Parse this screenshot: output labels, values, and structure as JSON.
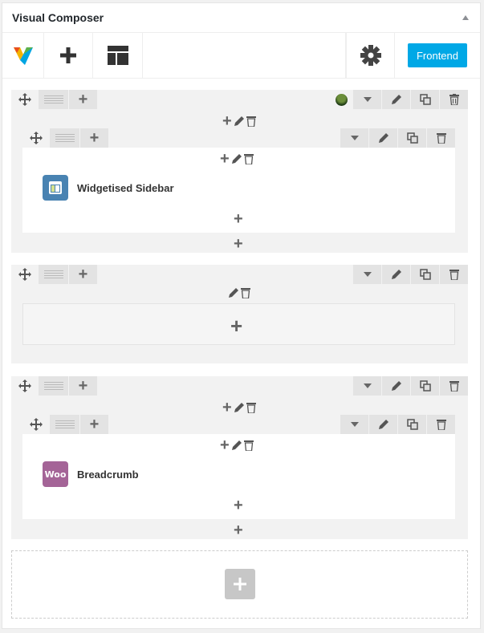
{
  "panel": {
    "title": "Visual Composer"
  },
  "toolbar": {
    "logo_icon": "vc-logo-icon",
    "add_icon": "plus-icon",
    "layout_icon": "templates-icon",
    "settings_icon": "gear-icon",
    "frontend_label": "Frontend"
  },
  "rows": [
    {
      "has_design": true,
      "inner_columns": [
        {
          "element": {
            "label": "Widgetised Sidebar",
            "icon": "widget-sidebar-icon",
            "color": "#4983b2"
          }
        }
      ]
    },
    {
      "has_design": false,
      "inner_columns": []
    },
    {
      "has_design": false,
      "inner_columns": [
        {
          "element": {
            "label": "Breadcrumb",
            "icon": "woo-icon",
            "icon_text": "Woo",
            "color": "#a46497"
          }
        }
      ]
    }
  ],
  "colors": {
    "accent": "#00a8e6",
    "row_bg": "#f2f2f2",
    "button_bg": "#e3e3e3"
  }
}
